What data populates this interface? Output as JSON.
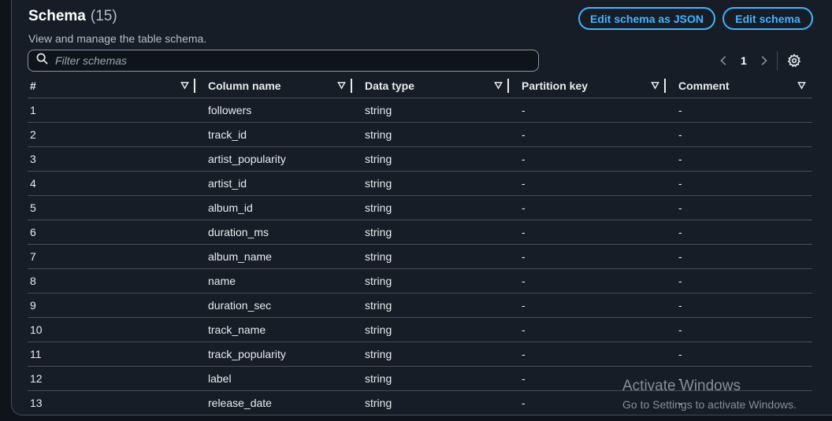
{
  "header": {
    "title": "Schema",
    "count": "(15)",
    "description": "View and manage the table schema.",
    "edit_json_label": "Edit schema as JSON",
    "edit_label": "Edit schema"
  },
  "search": {
    "placeholder": "Filter schemas",
    "value": ""
  },
  "pagination": {
    "current_page": "1"
  },
  "table": {
    "columns": [
      "#",
      "Column name",
      "Data type",
      "Partition key",
      "Comment"
    ],
    "rows": [
      [
        "1",
        "followers",
        "string",
        "-",
        "-"
      ],
      [
        "2",
        "track_id",
        "string",
        "-",
        "-"
      ],
      [
        "3",
        "artist_popularity",
        "string",
        "-",
        "-"
      ],
      [
        "4",
        "artist_id",
        "string",
        "-",
        "-"
      ],
      [
        "5",
        "album_id",
        "string",
        "-",
        "-"
      ],
      [
        "6",
        "duration_ms",
        "string",
        "-",
        "-"
      ],
      [
        "7",
        "album_name",
        "string",
        "-",
        "-"
      ],
      [
        "8",
        "name",
        "string",
        "-",
        "-"
      ],
      [
        "9",
        "duration_sec",
        "string",
        "-",
        "-"
      ],
      [
        "10",
        "track_name",
        "string",
        "-",
        "-"
      ],
      [
        "11",
        "track_popularity",
        "string",
        "-",
        "-"
      ],
      [
        "12",
        "label",
        "string",
        "-",
        "-"
      ],
      [
        "13",
        "release_date",
        "string",
        "-",
        "-"
      ]
    ]
  },
  "watermark": {
    "line1": "Activate Windows",
    "line2": "Go to Settings to activate Windows."
  },
  "icons": [
    "search-icon",
    "chevron-left-icon",
    "chevron-right-icon",
    "settings-gear-icon",
    "sort-triangle-icon"
  ],
  "colors": {
    "accent": "#42b4ff",
    "panel_bg": "#161d26",
    "border": "#414d5c"
  }
}
